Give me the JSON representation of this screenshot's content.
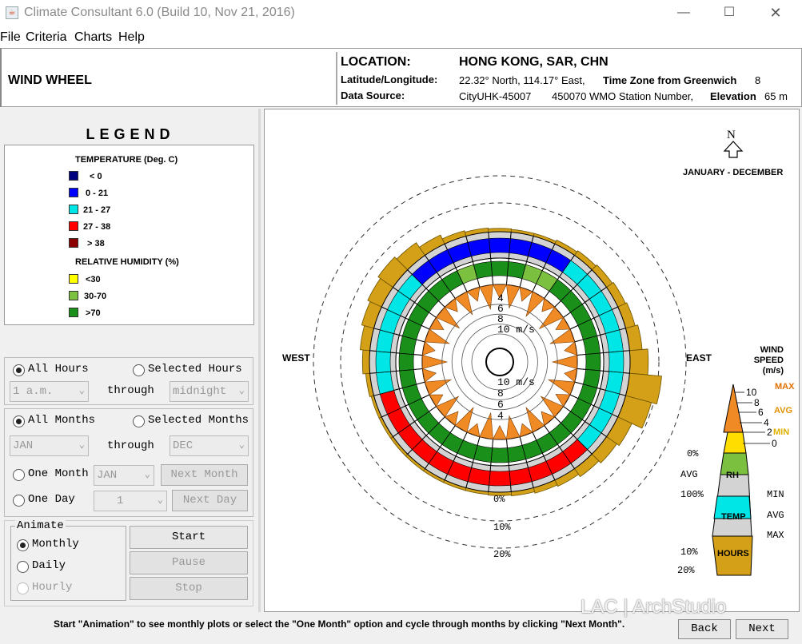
{
  "window": {
    "title": "Climate Consultant 6.0 (Build 10, Nov 21, 2016)",
    "app_icon": "java-cup-icon"
  },
  "menu": [
    "File",
    "Criteria",
    "Charts",
    "Help"
  ],
  "header": {
    "page_title": "WIND WHEEL",
    "location_label": "LOCATION:",
    "location_value": "HONG KONG, SAR, CHN",
    "latlon_label": "Latitude/Longitude:",
    "latlon_value": "22.32° North, 114.17° East,",
    "tz_label": "Time Zone from Greenwich",
    "tz_value": "8",
    "source_label": "Data Source:",
    "source_value": "CityUHK-45007",
    "station_value": "450070 WMO Station Number,",
    "elev_label": "Elevation",
    "elev_value": "65 m"
  },
  "legend": {
    "title": "LEGEND",
    "temp_title": "TEMPERATURE (Deg. C)",
    "temp_items": [
      {
        "label": "< 0",
        "color": "#000080"
      },
      {
        "label": "0  -  21",
        "color": "#0000ff"
      },
      {
        "label": "21  -  27",
        "color": "#00e6e6"
      },
      {
        "label": "27  -  38",
        "color": "#ff0000"
      },
      {
        "label": "> 38",
        "color": "#8b0000"
      }
    ],
    "rh_title": "RELATIVE HUMIDITY (%)",
    "rh_items": [
      {
        "label": "<30",
        "color": "#ffff00"
      },
      {
        "label": "30-70",
        "color": "#7cc040"
      },
      {
        "label": ">70",
        "color": "#1a8f1a"
      }
    ]
  },
  "hours": {
    "all": "All Hours",
    "selected": "Selected Hours",
    "from": "1 a.m.",
    "through": "through",
    "to": "midnight"
  },
  "months": {
    "all": "All Months",
    "selected": "Selected Months",
    "from": "JAN",
    "through": "through",
    "to": "DEC",
    "one_month": "One Month",
    "one_month_value": "JAN",
    "next_month": "Next Month",
    "one_day": "One Day",
    "one_day_value": "1",
    "next_day": "Next Day"
  },
  "animate": {
    "legend": "Animate",
    "monthly": "Monthly",
    "daily": "Daily",
    "hourly": "Hourly",
    "start": "Start",
    "pause": "Pause",
    "stop": "Stop"
  },
  "chart": {
    "north": "N",
    "period": "JANUARY - DECEMBER",
    "west": "WEST",
    "east": "EAST",
    "ring_labels": [
      "0%",
      "10%",
      "20%"
    ],
    "speed_labels_upper": [
      "4",
      "6",
      "8",
      "10 m/s"
    ],
    "speed_labels_lower": [
      "10 m/s",
      "8",
      "6",
      "4"
    ],
    "key": {
      "title": [
        "WIND",
        "SPEED",
        "(m/s)"
      ],
      "max": "MAX",
      "avg": "AVG",
      "min": "MIN",
      "speeds": [
        "10",
        "8",
        "6",
        "4",
        "2",
        "0"
      ],
      "rh": "RH",
      "rh_left": [
        "0%",
        "AVG",
        "100%"
      ],
      "temp": "TEMP",
      "temp_right": [
        "MIN",
        "AVG",
        "MAX"
      ],
      "hours": "HOURS",
      "hours_left": [
        "10%",
        "20%"
      ]
    }
  },
  "status": {
    "message": "Start \"Animation\" to see monthly plots or select the \"One Month\" option and cycle through months by clicking \"Next Month\".",
    "back": "Back",
    "next": "Next"
  },
  "watermark": "LAC | ArchStudio",
  "chart_data": {
    "type": "radar",
    "directions": 36,
    "speed_scale_ms": [
      4,
      6,
      8,
      10
    ],
    "hours_scale_pct": [
      0,
      10,
      20
    ],
    "avg_speed_ms": [
      2.8,
      4.6,
      2.6,
      5.0,
      2.4,
      5.2,
      2.6,
      4.8,
      2.4,
      5.0,
      2.4,
      5.2,
      2.6,
      4.8,
      2.6,
      5.0,
      2.4,
      4.6,
      2.8,
      5.2,
      2.4,
      5.0,
      2.6,
      4.8,
      2.4,
      5.2,
      2.6,
      5.0,
      2.4,
      4.8,
      2.6,
      5.0,
      2.4,
      4.6,
      2.6,
      4.8
    ],
    "hours_pct": [
      1.2,
      1.0,
      1.0,
      1.5,
      2.0,
      2.5,
      3.0,
      3.5,
      4.5,
      6.5,
      11.5,
      9.5,
      5.5,
      4.5,
      3.5,
      2.5,
      2.0,
      1.5,
      1.2,
      1.0,
      1.0,
      1.0,
      1.0,
      1.0,
      1.0,
      1.0,
      1.5,
      2.5,
      3.5,
      4.5,
      5.5,
      6.5,
      5.5,
      3.5,
      2.0,
      1.5
    ],
    "temp_class": [
      "0-21",
      "0-21",
      "0-21",
      "0-21",
      "21-27",
      "21-27",
      "21-27",
      "21-27",
      "21-27",
      "21-27",
      "21-27",
      "21-27",
      "21-27",
      "21-27",
      "27-38",
      "27-38",
      "27-38",
      "27-38",
      "27-38",
      "27-38",
      "27-38",
      "27-38",
      "27-38",
      "27-38",
      "27-38",
      "27-38",
      "21-27",
      "21-27",
      "21-27",
      "21-27",
      "21-27",
      "21-27",
      "0-21",
      "0-21",
      "0-21",
      "0-21"
    ],
    "rh_class": [
      ">70",
      ">70",
      "30-70",
      "30-70",
      ">70",
      ">70",
      ">70",
      ">70",
      ">70",
      ">70",
      ">70",
      ">70",
      ">70",
      ">70",
      ">70",
      ">70",
      ">70",
      ">70",
      ">70",
      ">70",
      ">70",
      ">70",
      ">70",
      ">70",
      ">70",
      ">70",
      ">70",
      ">70",
      ">70",
      ">70",
      ">70",
      ">70",
      ">70",
      ">70",
      "30-70",
      ">70"
    ]
  }
}
